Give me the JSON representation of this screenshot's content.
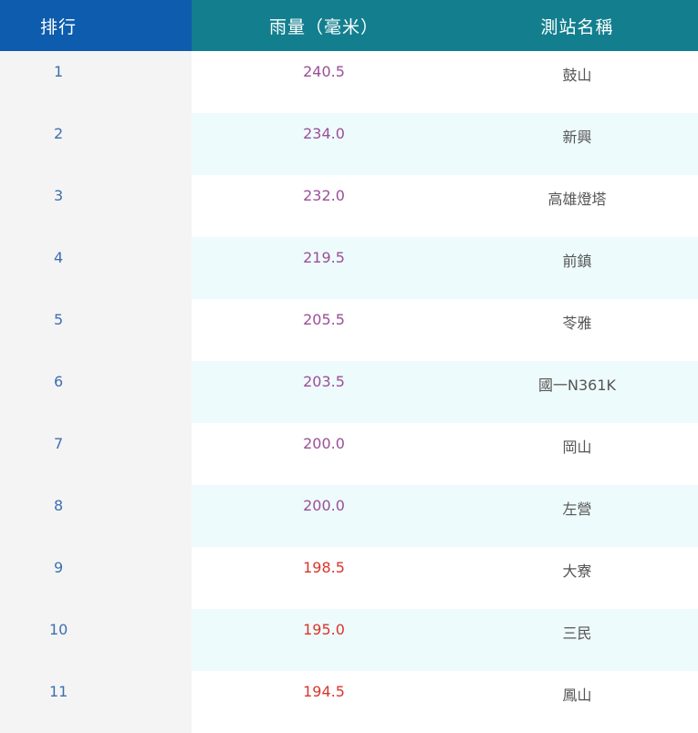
{
  "headers": {
    "rank": "排行",
    "rain": "雨量（毫米）",
    "station": "測站名稱"
  },
  "colors": {
    "rank_header": "#0d5cad",
    "other_header": "#137f8e",
    "rank_text": "#3d6fb0",
    "value_purple": "#9b4f96",
    "value_red": "#d9362c",
    "row_alt": "#eefbfc",
    "rank_col_bg": "#f4f4f4"
  },
  "rows": [
    {
      "rank": "1",
      "rain": "240.5",
      "station": "鼓山",
      "tier": "purple"
    },
    {
      "rank": "2",
      "rain": "234.0",
      "station": "新興",
      "tier": "purple"
    },
    {
      "rank": "3",
      "rain": "232.0",
      "station": "高雄燈塔",
      "tier": "purple"
    },
    {
      "rank": "4",
      "rain": "219.5",
      "station": "前鎮",
      "tier": "purple"
    },
    {
      "rank": "5",
      "rain": "205.5",
      "station": "苓雅",
      "tier": "purple"
    },
    {
      "rank": "6",
      "rain": "203.5",
      "station": "國一N361K",
      "tier": "purple"
    },
    {
      "rank": "7",
      "rain": "200.0",
      "station": "岡山",
      "tier": "purple"
    },
    {
      "rank": "8",
      "rain": "200.0",
      "station": "左營",
      "tier": "purple"
    },
    {
      "rank": "9",
      "rain": "198.5",
      "station": "大寮",
      "tier": "red"
    },
    {
      "rank": "10",
      "rain": "195.0",
      "station": "三民",
      "tier": "red"
    },
    {
      "rank": "11",
      "rain": "194.5",
      "station": "鳳山",
      "tier": "red"
    }
  ]
}
